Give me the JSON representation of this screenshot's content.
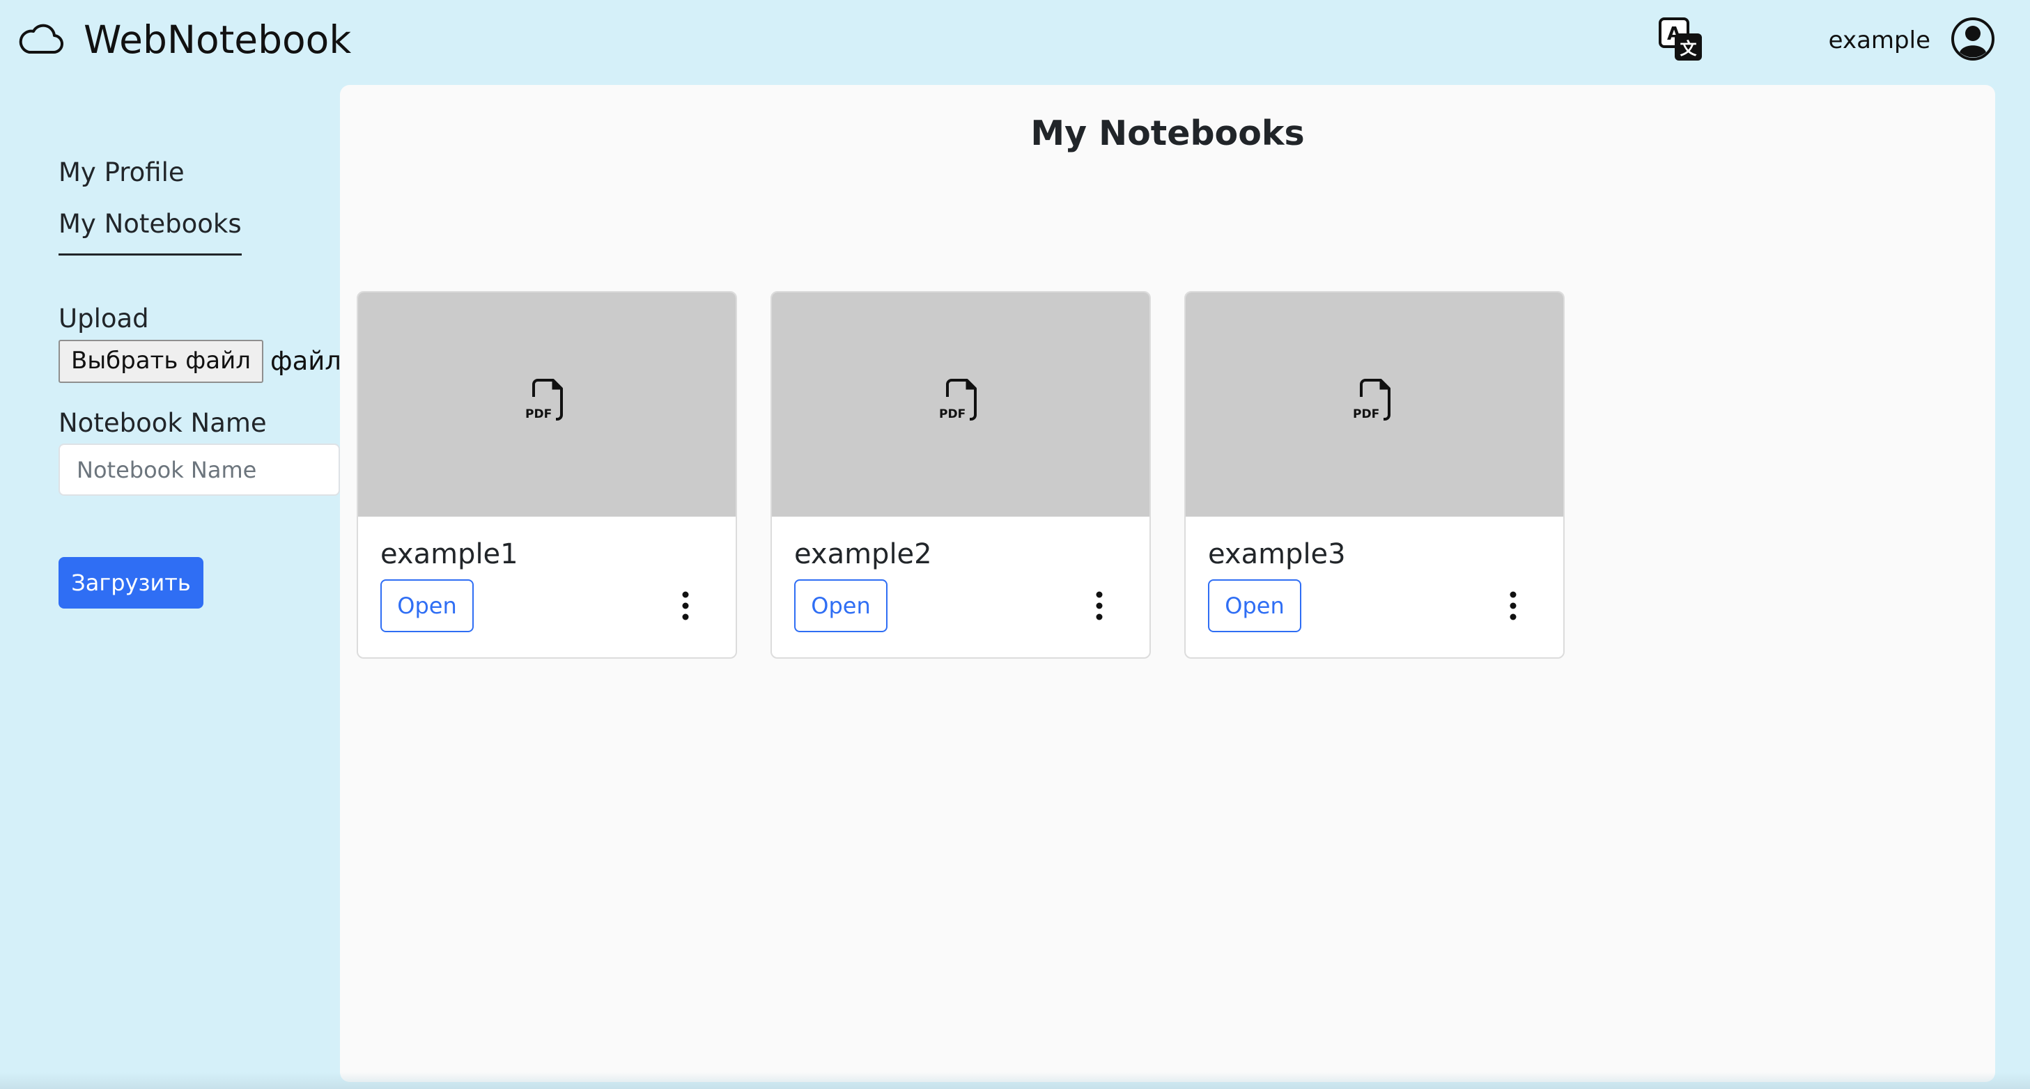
{
  "header": {
    "brand_name": "WebNotebook",
    "brand_icon": "cloud-icon",
    "translate_icon": "translate-icon",
    "username": "example",
    "avatar_icon": "user-circle-icon"
  },
  "sidebar": {
    "nav": [
      {
        "label": "My Profile"
      },
      {
        "label": "My Notebooks",
        "active": true
      }
    ],
    "upload_label": "Upload",
    "file_button_label": "Выбрать файл",
    "file_status": "файл н",
    "notebook_name_label": "Notebook Name",
    "notebook_name_placeholder": "Notebook Name",
    "notebook_name_value": "",
    "submit_label": "Загрузить"
  },
  "main": {
    "title": "My Notebooks",
    "notebooks": [
      {
        "name": "example1",
        "open_label": "Open",
        "thumb_icon": "pdf-file-icon",
        "menu_icon": "kebab-menu-icon"
      },
      {
        "name": "example2",
        "open_label": "Open",
        "thumb_icon": "pdf-file-icon",
        "menu_icon": "kebab-menu-icon"
      },
      {
        "name": "example3",
        "open_label": "Open",
        "thumb_icon": "pdf-file-icon",
        "menu_icon": "kebab-menu-icon"
      }
    ]
  },
  "colors": {
    "background": "#d5f0f9",
    "panel": "#fafafa",
    "accent": "#2f6ef4",
    "thumbnail": "#cbcbcb"
  }
}
